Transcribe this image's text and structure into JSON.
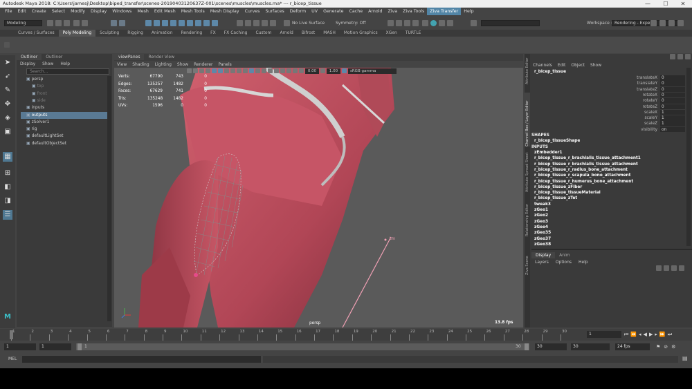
{
  "window": {
    "title": "Autodesk Maya 2018: C:\\Users\\jamesj\\Desktop\\biped_transfer\\scenes-20190403120637Z-001\\scenes\\muscles\\muscles.ma*   ---   r_bicep_tissue",
    "minimize": "—",
    "maximize": "☐",
    "close": "✕"
  },
  "menubar": [
    "File",
    "Edit",
    "Create",
    "Select",
    "Modify",
    "Display",
    "Windows",
    "Mesh",
    "Edit Mesh",
    "Mesh Tools",
    "Mesh Display",
    "Curves",
    "Surfaces",
    "Deform",
    "UV",
    "Generate",
    "Cache",
    "Arnold",
    "Ziva",
    "Ziva Tools",
    "Ziva Transfer",
    "Help"
  ],
  "menubar_highlight": "Ziva Transfer",
  "statusline": {
    "mode": "Modeling",
    "live_surface": "No Live Surface",
    "symmetry": "Symmetry: Off",
    "workspace_label": "Workspace :",
    "workspace": "Rendering - Expert*"
  },
  "shelf_tabs": [
    "Curves / Surfaces",
    "Poly Modeling",
    "Sculpting",
    "Rigging",
    "Animation",
    "Rendering",
    "FX",
    "FX Caching",
    "Custom",
    "Arnold",
    "Bifrost",
    "MASH",
    "Motion Graphics",
    "XGen",
    "TURTLE"
  ],
  "shelf_active": "Poly Modeling",
  "outliner": {
    "tabs": [
      "Outliner",
      "Outliner"
    ],
    "menu": [
      "Display",
      "Show",
      "Help"
    ],
    "search_placeholder": "Search...",
    "items": [
      {
        "label": "persp",
        "state": "normal"
      },
      {
        "label": "top",
        "state": "dim"
      },
      {
        "label": "front",
        "state": "dim"
      },
      {
        "label": "side",
        "state": "dim"
      },
      {
        "label": "inputs",
        "state": "normal"
      },
      {
        "label": "outputs",
        "state": "selected"
      },
      {
        "label": "zSolver1",
        "state": "normal"
      },
      {
        "label": "rig",
        "state": "normal"
      },
      {
        "label": "defaultLightSet",
        "state": "normal"
      },
      {
        "label": "defaultObjectSet",
        "state": "normal"
      }
    ]
  },
  "viewport": {
    "tabs": [
      "viewPanes",
      "Render View"
    ],
    "menu": [
      "View",
      "Shading",
      "Lighting",
      "Show",
      "Renderer",
      "Panels"
    ],
    "exposure": "0.00",
    "gamma": "1.00",
    "color_space": "sRGB gamma",
    "hud_labels": [
      "Verts:",
      "Edges:",
      "Faces:",
      "Tris:",
      "UVs:"
    ],
    "hud_col1": [
      "67790",
      "135257",
      "67629",
      "135248",
      "1596"
    ],
    "hud_col2": [
      "743",
      "1482",
      "741",
      "1482",
      "0"
    ],
    "hud_col3": [
      "0",
      "0",
      "0",
      "0",
      "0"
    ],
    "camera": "persp",
    "fps": "13.8 fps",
    "locator": "tm"
  },
  "channel_box": {
    "menu": [
      "Channels",
      "Edit",
      "Object",
      "Show"
    ],
    "object": "r_bicep_tissue",
    "attributes": [
      {
        "name": "translateX",
        "value": "0"
      },
      {
        "name": "translateY",
        "value": "0"
      },
      {
        "name": "translateZ",
        "value": "0"
      },
      {
        "name": "rotateX",
        "value": "0"
      },
      {
        "name": "rotateY",
        "value": "0"
      },
      {
        "name": "rotateZ",
        "value": "0"
      },
      {
        "name": "scaleX",
        "value": "1"
      },
      {
        "name": "scaleY",
        "value": "1"
      },
      {
        "name": "scaleZ",
        "value": "1"
      },
      {
        "name": "visibility",
        "value": "on"
      }
    ],
    "shapes_header": "SHAPES",
    "shape": "r_bicep_tissueShape",
    "inputs_header": "INPUTS",
    "inputs": [
      "zEmbedder1",
      "r_bicep_tissue_r_brachialis_tissue_attachment1",
      "r_bicep_tissue_r_brachialis_tissue_attachment",
      "r_bicep_tissue_r_radius_bone_attachment",
      "r_bicep_tissue_r_scapula_bone_attachment",
      "r_bicep_tissue_r_humerus_bone_attachment",
      "r_bicep_tissue_zFiber",
      "r_bicep_tissue_tissueMaterial",
      "r_bicep_tissue_zTet",
      "tweak3",
      "zGeo1",
      "zGeo2",
      "zGeo3",
      "zGeo4",
      "zGeo35",
      "zGeo37",
      "zGeo38"
    ]
  },
  "side_tabs": [
    "Attribute Editor",
    "Channel Box / Layer Editor",
    "Attribute Spread Sheet",
    "Relationship Editor",
    "Ziva Scene Panel"
  ],
  "layer_editor": {
    "tabs": [
      "Display",
      "Anim"
    ],
    "menu": [
      "Layers",
      "Options",
      "Help"
    ]
  },
  "timeline": {
    "current_frame": "1",
    "ticks": [
      "1",
      "2",
      "3",
      "4",
      "5",
      "6",
      "7",
      "8",
      "9",
      "10",
      "11",
      "12",
      "13",
      "14",
      "15",
      "16",
      "17",
      "18",
      "19",
      "20",
      "21",
      "22",
      "23",
      "24",
      "25",
      "26",
      "27",
      "28",
      "29",
      "30"
    ]
  },
  "range": {
    "start": "1",
    "anim_start": "1",
    "slider_start": "1",
    "slider_end": "30",
    "end": "30",
    "anim_end": "30",
    "fps": "24 fps"
  },
  "mel": {
    "label": "MEL"
  },
  "colors": {
    "accent": "#5285a6",
    "muscle": "#b54a5a",
    "tendon": "#c8c8c8"
  }
}
